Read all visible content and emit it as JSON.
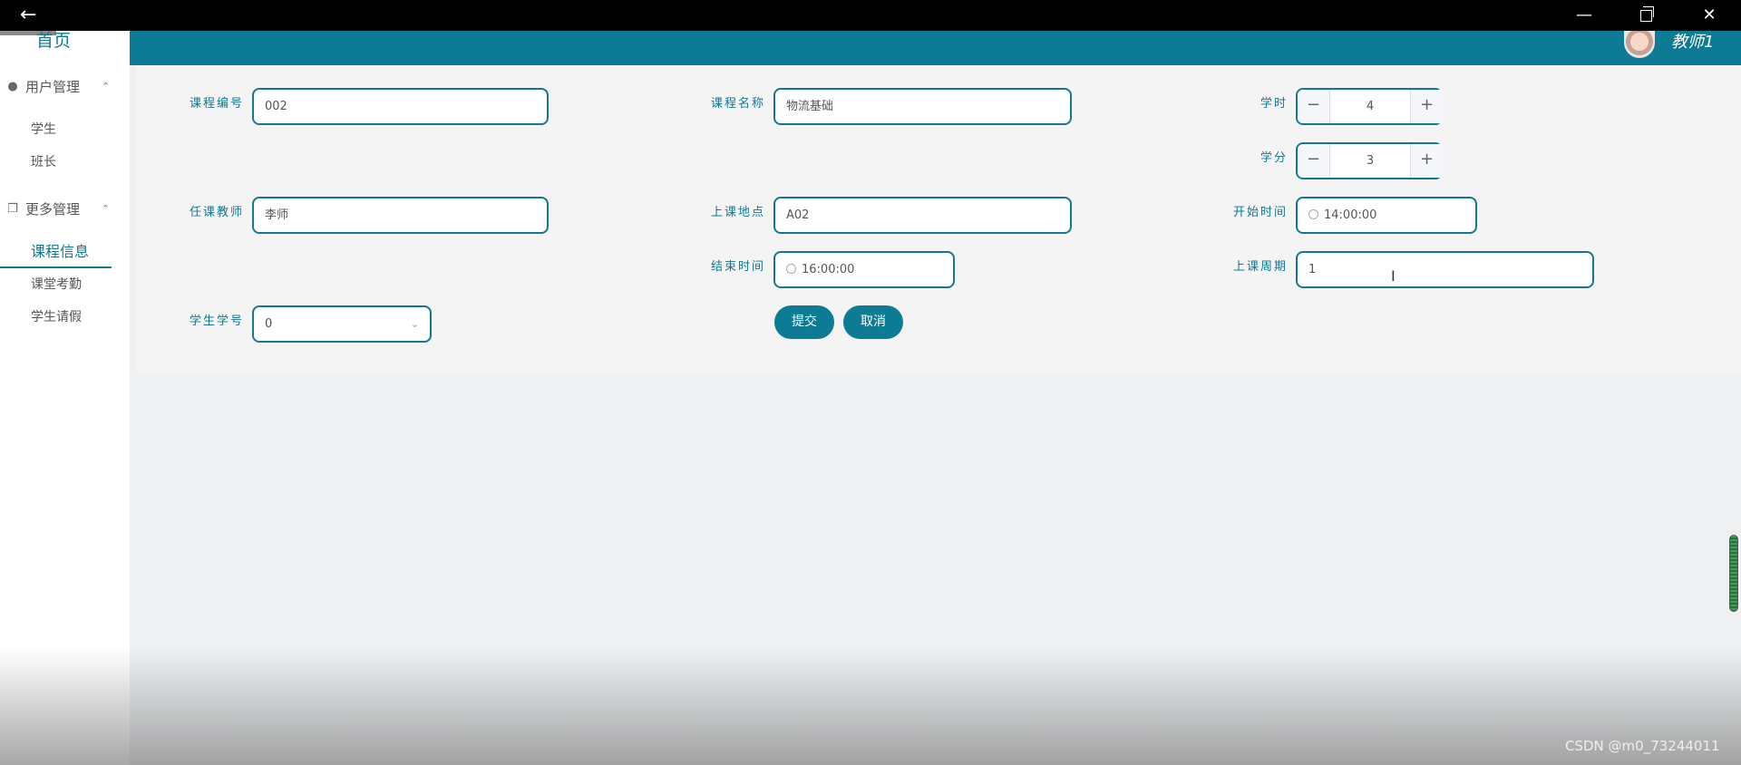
{
  "sidebar": {
    "home": "首页",
    "groups": [
      {
        "label": "用户管理",
        "icon": "user-icon",
        "items": [
          "学生",
          "班长"
        ]
      },
      {
        "label": "更多管理",
        "icon": "copy-icon",
        "items": [
          "课程信息",
          "课堂考勤",
          "学生请假"
        ]
      }
    ],
    "active_item": "课程信息"
  },
  "header": {
    "username": "教师1"
  },
  "form": {
    "course_no": {
      "label": "课程编号",
      "value": "002"
    },
    "course_name": {
      "label": "课程名称",
      "value": "物流基础"
    },
    "hours": {
      "label": "学时",
      "value": "4"
    },
    "credits": {
      "label": "学分",
      "value": "3"
    },
    "teacher": {
      "label": "任课教师",
      "value": "李师"
    },
    "location": {
      "label": "上课地点",
      "value": "A02"
    },
    "start_time": {
      "label": "开始时间",
      "value": "14:00:00"
    },
    "end_time": {
      "label": "结束时间",
      "value": "16:00:00"
    },
    "period": {
      "label": "上课周期",
      "value": "1"
    },
    "student_no": {
      "label": "学生学号",
      "value": "0"
    },
    "submit": "提交",
    "cancel": "取消"
  },
  "watermark": "CSDN @m0_73244011",
  "colors": {
    "accent": "#0c7b93",
    "sidebar_bg": "#ffffff",
    "panel_bg": "#f4f4f4"
  }
}
